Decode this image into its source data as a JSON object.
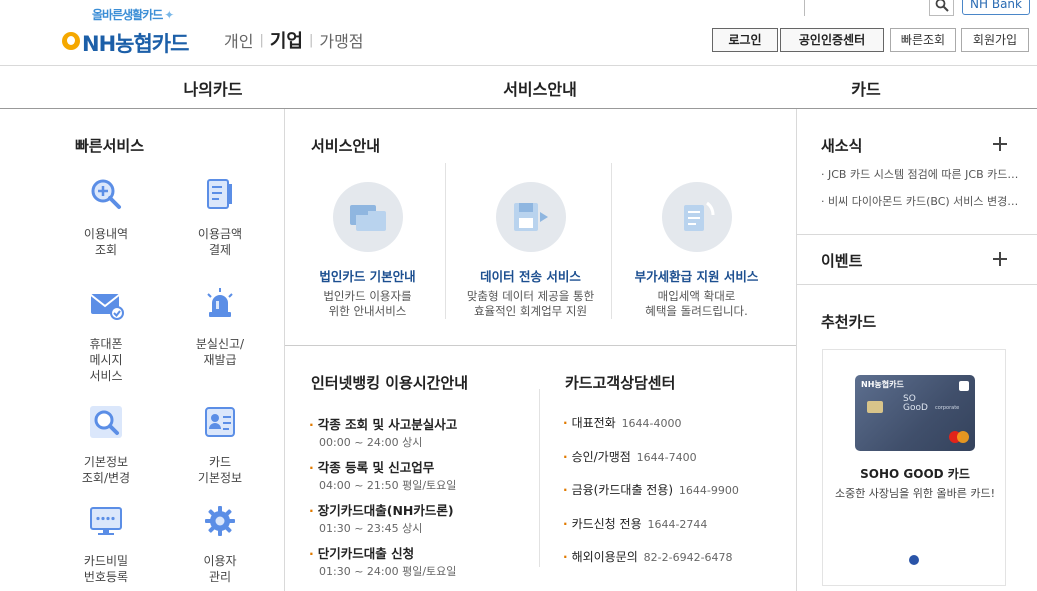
{
  "header": {
    "logo_tagline": "올바른생활카드",
    "logo_brand": "NH농협카드",
    "segments": [
      "개인",
      "기업",
      "가맹점"
    ],
    "active_segment": "기업",
    "search": {
      "placeholder": "",
      "value": ""
    },
    "nh_bank": "NH Bank",
    "buttons": {
      "login": "로그인",
      "cert": "공인인증센터",
      "quick": "빠른조회",
      "join": "회원가입"
    }
  },
  "gnb": {
    "items": [
      "나의카드",
      "서비스안내",
      "카드"
    ]
  },
  "quick_service": {
    "title": "빠른서비스",
    "items": [
      {
        "label": "이용내역\n조회",
        "icon": "magnifier-plus-icon"
      },
      {
        "label": "이용금액\n결제",
        "icon": "document-icon"
      },
      {
        "label": "휴대폰\n메시지\n서비스",
        "icon": "envelope-icon"
      },
      {
        "label": "분실신고/\n재발급",
        "icon": "siren-icon"
      },
      {
        "label": "기본정보\n조회/변경",
        "icon": "search-icon"
      },
      {
        "label": "카드\n기본정보",
        "icon": "id-card-icon"
      },
      {
        "label": "카드비밀\n번호등록",
        "icon": "monitor-password-icon"
      },
      {
        "label": "이용자\n관리",
        "icon": "gear-icon"
      }
    ]
  },
  "service_guide": {
    "title": "서비스안내",
    "cards": [
      {
        "title": "법인카드 기본안내",
        "desc": "법인카드 이용자를\n위한 안내서비스",
        "icon": "folder-icon"
      },
      {
        "title": "데이터 전송 서비스",
        "desc": "맞춤형 데이터 제공을 통한\n효율적인 회계업무 지원",
        "icon": "floppy-transfer-icon"
      },
      {
        "title": "부가세환급 지원 서비스",
        "desc": "매입세액 확대로\n혜택을 돌려드립니다.",
        "icon": "refresh-document-icon"
      }
    ]
  },
  "internet_banking": {
    "title": "인터넷뱅킹 이용시간안내",
    "items": [
      {
        "title": "각종 조회 및 사고분실사고",
        "time": "00:00 ~ 24:00 상시"
      },
      {
        "title": "각종 등록 및 신고업무",
        "time": "04:00 ~ 21:50 평일/토요일"
      },
      {
        "title": "장기카드대출(NH카드론)",
        "time": "01:30 ~ 23:45 상시"
      },
      {
        "title": "단기카드대출 신청",
        "time": "01:30 ~ 24:00 평일/토요일"
      }
    ]
  },
  "call_center": {
    "title": "카드고객상담센터",
    "items": [
      {
        "label": "대표전화",
        "number": "1644-4000"
      },
      {
        "label": "승인/가맹점",
        "number": "1644-7400"
      },
      {
        "label": "금융(카드대출 전용)",
        "number": "1644-9900"
      },
      {
        "label": "카드신청 전용",
        "number": "1644-2744"
      },
      {
        "label": "해외이용문의",
        "number": "82-2-6942-6478"
      }
    ]
  },
  "news": {
    "title": "새소식",
    "items": [
      "JCB 카드 시스템 점검에 따른 JCB 카드 이용 제한 안내",
      "비씨 다이아몬드 카드(BC) 서비스 변경 안내"
    ]
  },
  "event": {
    "title": "이벤트"
  },
  "recommend": {
    "title": "추천카드",
    "card_brand": "NH농협카드",
    "card_logo": "SO\nGooD",
    "card_sub": "corporate",
    "card_name": "SOHO GOOD 카드",
    "card_desc": "소중한 사장님을 위한 올바른 카드!"
  },
  "colors": {
    "brand": "#1c5fa8",
    "accent": "#e07a00",
    "link": "#1c4f90",
    "dot": "#2a54a8"
  }
}
